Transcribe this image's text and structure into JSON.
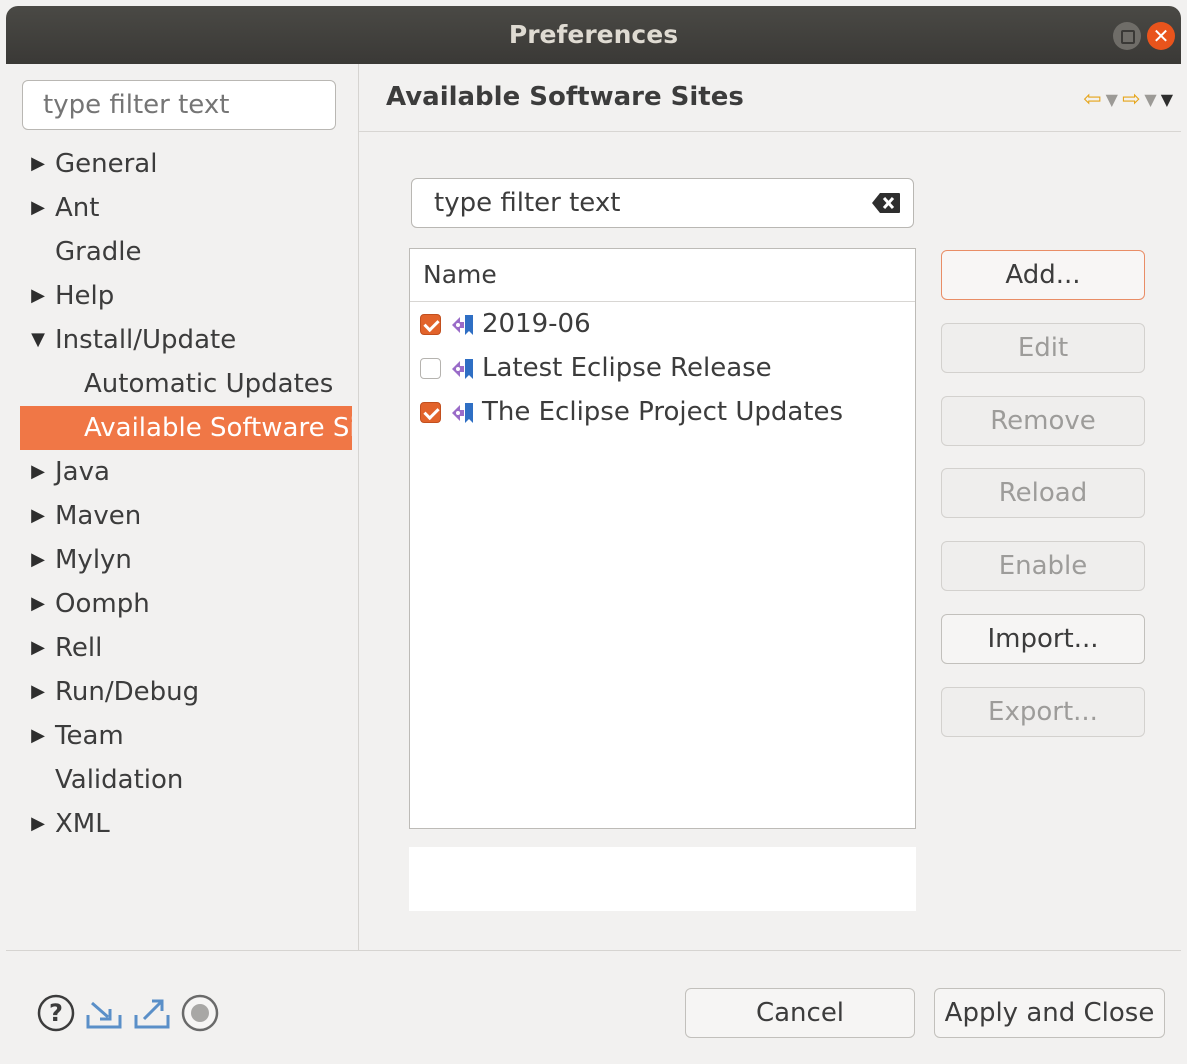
{
  "window": {
    "title": "Preferences",
    "close_glyph": "✕"
  },
  "left": {
    "search_placeholder": "type filter text",
    "tree": [
      {
        "label": "General",
        "twisty": "collapsed"
      },
      {
        "label": "Ant",
        "twisty": "collapsed"
      },
      {
        "label": "Gradle",
        "twisty": "none"
      },
      {
        "label": "Help",
        "twisty": "collapsed"
      },
      {
        "label": "Install/Update",
        "twisty": "expanded"
      },
      {
        "label": "Automatic Updates",
        "twisty": "child"
      },
      {
        "label": "Available Software Sites",
        "twisty": "child-selected"
      },
      {
        "label": "Java",
        "twisty": "collapsed"
      },
      {
        "label": "Maven",
        "twisty": "collapsed"
      },
      {
        "label": "Mylyn",
        "twisty": "collapsed"
      },
      {
        "label": "Oomph",
        "twisty": "collapsed"
      },
      {
        "label": "Rell",
        "twisty": "collapsed"
      },
      {
        "label": "Run/Debug",
        "twisty": "collapsed"
      },
      {
        "label": "Team",
        "twisty": "collapsed"
      },
      {
        "label": "Validation",
        "twisty": "none"
      },
      {
        "label": "XML",
        "twisty": "collapsed"
      }
    ]
  },
  "page": {
    "title": "Available Software Sites",
    "nav_icons": [
      "back-arrow-icon",
      "back-dropdown-icon",
      "forward-arrow-icon",
      "forward-dropdown-icon",
      "view-menu-icon"
    ],
    "filter_value": "type filter text",
    "table": {
      "column": "Name",
      "rows": [
        {
          "label": "2019-06",
          "checked": true
        },
        {
          "label": "Latest Eclipse Release",
          "checked": false
        },
        {
          "label": "The Eclipse Project Updates",
          "checked": true
        }
      ]
    },
    "buttons": {
      "add": "Add...",
      "edit": "Edit",
      "remove": "Remove",
      "reload": "Reload",
      "enable": "Enable",
      "import": "Import...",
      "export": "Export..."
    }
  },
  "footer": {
    "icons": [
      "help-icon",
      "import-preferences-icon",
      "export-preferences-icon",
      "record-icon"
    ],
    "cancel": "Cancel",
    "apply_close": "Apply and Close"
  },
  "colors": {
    "accent": "#f07746",
    "title_bar": "#3c3b37",
    "close_button": "#e9541c",
    "nav_arrow": "#e6a51a"
  }
}
